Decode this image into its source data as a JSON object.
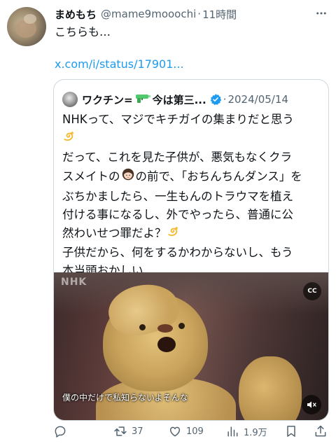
{
  "tweet": {
    "display_name": "まめもち",
    "handle": "@mame9mooochi",
    "separator": "·",
    "time": "11時間",
    "text": "こちらも…",
    "link": "x.com/i/status/17901..."
  },
  "quote": {
    "name_prefix": "ワクチン=",
    "name_suffix": "今は第三...",
    "separator": "·",
    "date": "2024/05/14",
    "lines": [
      "NHKって、マジでキチガイの集まりだと思う",
      "だって、これを見た子供が、悪気もなくクラ",
      "スメイトの",
      "の前で、「おちんちんダンス」を",
      "ぶちかましたら、一生もんのトラウマを植え",
      "付ける事になるし、外でやったら、普通に公",
      "然わいせつ罪だよ？",
      "子供だから、何をするかわからないし、もう",
      "本当頭おかしい"
    ],
    "video": {
      "logo": "NHK",
      "cc_label": "CC",
      "subtitle": "僕の中だけで私知らないよそんな"
    }
  },
  "actions": {
    "reply_count": "",
    "retweet_count": "37",
    "like_count": "109",
    "view_count": "1.9万"
  },
  "colors": {
    "link": "#1d9bf0",
    "secondary": "#536471",
    "verified": "#1d9bf0"
  },
  "icons": [
    "more-icon",
    "water-gun-icon",
    "verified-badge-icon",
    "dizzy-emoji-icon",
    "girl-emoji-icon",
    "cc-icon",
    "mute-icon",
    "reply-icon",
    "retweet-icon",
    "like-icon",
    "views-icon",
    "bookmark-icon",
    "share-icon"
  ]
}
